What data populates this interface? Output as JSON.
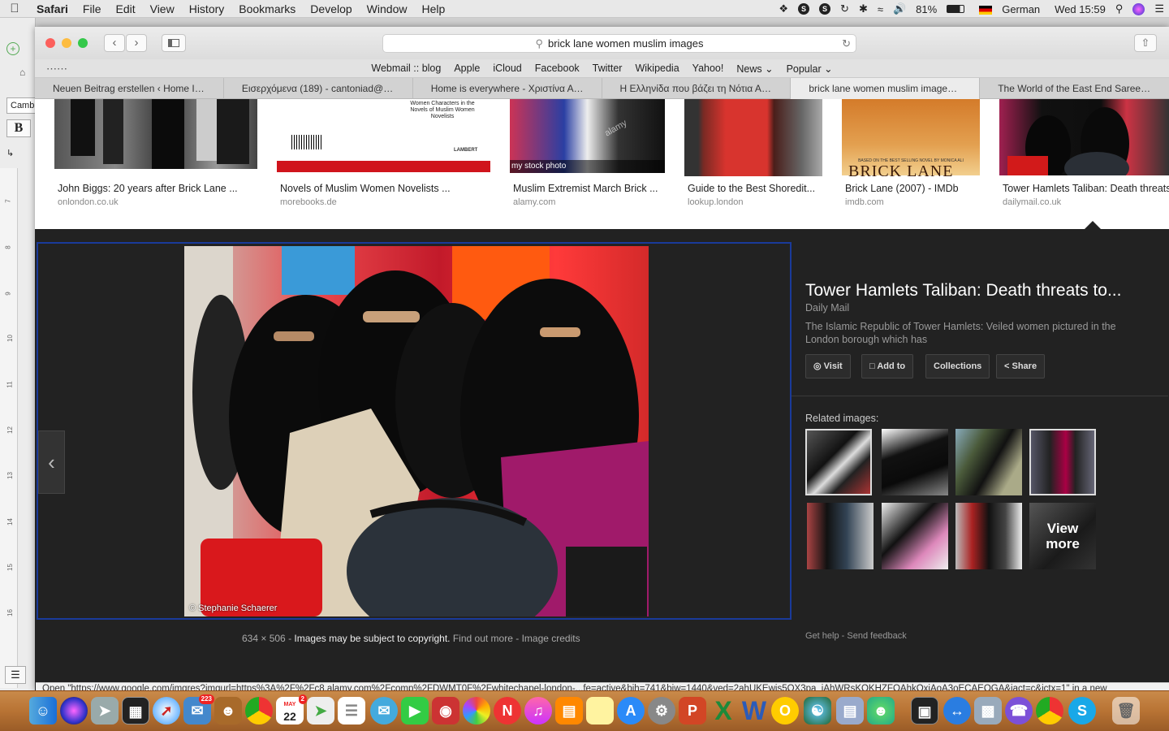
{
  "menubar": {
    "app": "Safari",
    "items": [
      "File",
      "Edit",
      "View",
      "History",
      "Bookmarks",
      "Develop",
      "Window",
      "Help"
    ],
    "battery": "81%",
    "language": "German",
    "clock": "Wed 15:59"
  },
  "background_window": {
    "font_box": "Camb",
    "bold_button": "B",
    "ruler_numbers": [
      "7",
      "8",
      "9",
      "10",
      "11",
      "12",
      "13",
      "14",
      "15",
      "16"
    ]
  },
  "toolbar": {
    "address": "brick lane women muslim images"
  },
  "favorites": [
    "Webmail :: blog",
    "Apple",
    "iCloud",
    "Facebook",
    "Twitter",
    "Wikipedia",
    "Yahoo!",
    "News ⌄",
    "Popular ⌄"
  ],
  "tabs": [
    {
      "label": "Neuen Beitrag erstellen ‹ Home Is..."
    },
    {
      "label": "Εισερχόμενα (189) - cantoniad@g..."
    },
    {
      "label": "Home is everywhere - Χριστίνα Αντ..."
    },
    {
      "label": "Η Ελληνίδα που βάζει τη Νότια Αφ..."
    },
    {
      "label": "brick lane women muslim images -..."
    },
    {
      "label": "The World of the East End Saree S..."
    }
  ],
  "results": [
    {
      "caption": "John Biggs: 20 years after Brick Lane ...",
      "source": "onlondon.co.uk"
    },
    {
      "caption": "Novels of Muslim Women Novelists ...",
      "source": "morebooks.de",
      "book_text": "Women Characters in the Novels of Muslim Women Novelists",
      "publisher": "LAMBERT"
    },
    {
      "caption": "Muslim Extremist March Brick ...",
      "source": "alamy.com",
      "overlay": "my stock photo",
      "watermark": "alamy"
    },
    {
      "caption": "Guide to the Best Shoredit...",
      "source": "lookup.london"
    },
    {
      "caption": "Brick Lane (2007) - IMDb",
      "source": "imdb.com",
      "poster_text": "BRICK LANE",
      "poster_tag": "BASED ON THE BEST SELLING NOVEL BY MONICA ALI"
    },
    {
      "caption": "Tower Hamlets Taliban: Death threats ...",
      "source": "dailymail.co.uk"
    }
  ],
  "preview": {
    "photo_credit": "© Stephanie Schaerer",
    "dimensions": "634 × 506",
    "copyright_notice": "Images may be subject to copyright.",
    "find_out_more": "Find out more",
    "image_credits": "Image credits",
    "separator": "-"
  },
  "details": {
    "title": "Tower Hamlets Taliban: Death threats to...",
    "source": "Daily Mail",
    "description": "The Islamic Republic of Tower Hamlets: Veiled women pictured in the London borough which has",
    "actions": {
      "visit": "Visit",
      "add_to": "Add to",
      "collections": "Collections",
      "share": "Share"
    },
    "related_heading": "Related images:",
    "view_more": "View more",
    "get_help": "Get help",
    "send_feedback": "Send feedback"
  },
  "status_bar": "Open \"https://www.google.com/imgres?imgurl=https%3A%2F%2Fc8.alamy.com%2Fcomp%2FDWMT0F%2Fwhitechapel-london-...fe=active&bih=741&biw=1440&ved=2ahUKEwis5OX3pa_jAhWRsKQKHZFOAhkQxiAoA3oECAEQGA&iact=c&ictx=1\" in a new",
  "dock": {
    "calendar_month": "MAY",
    "calendar_day": "22",
    "mail_badge": "223",
    "calendar_badge": "2"
  }
}
